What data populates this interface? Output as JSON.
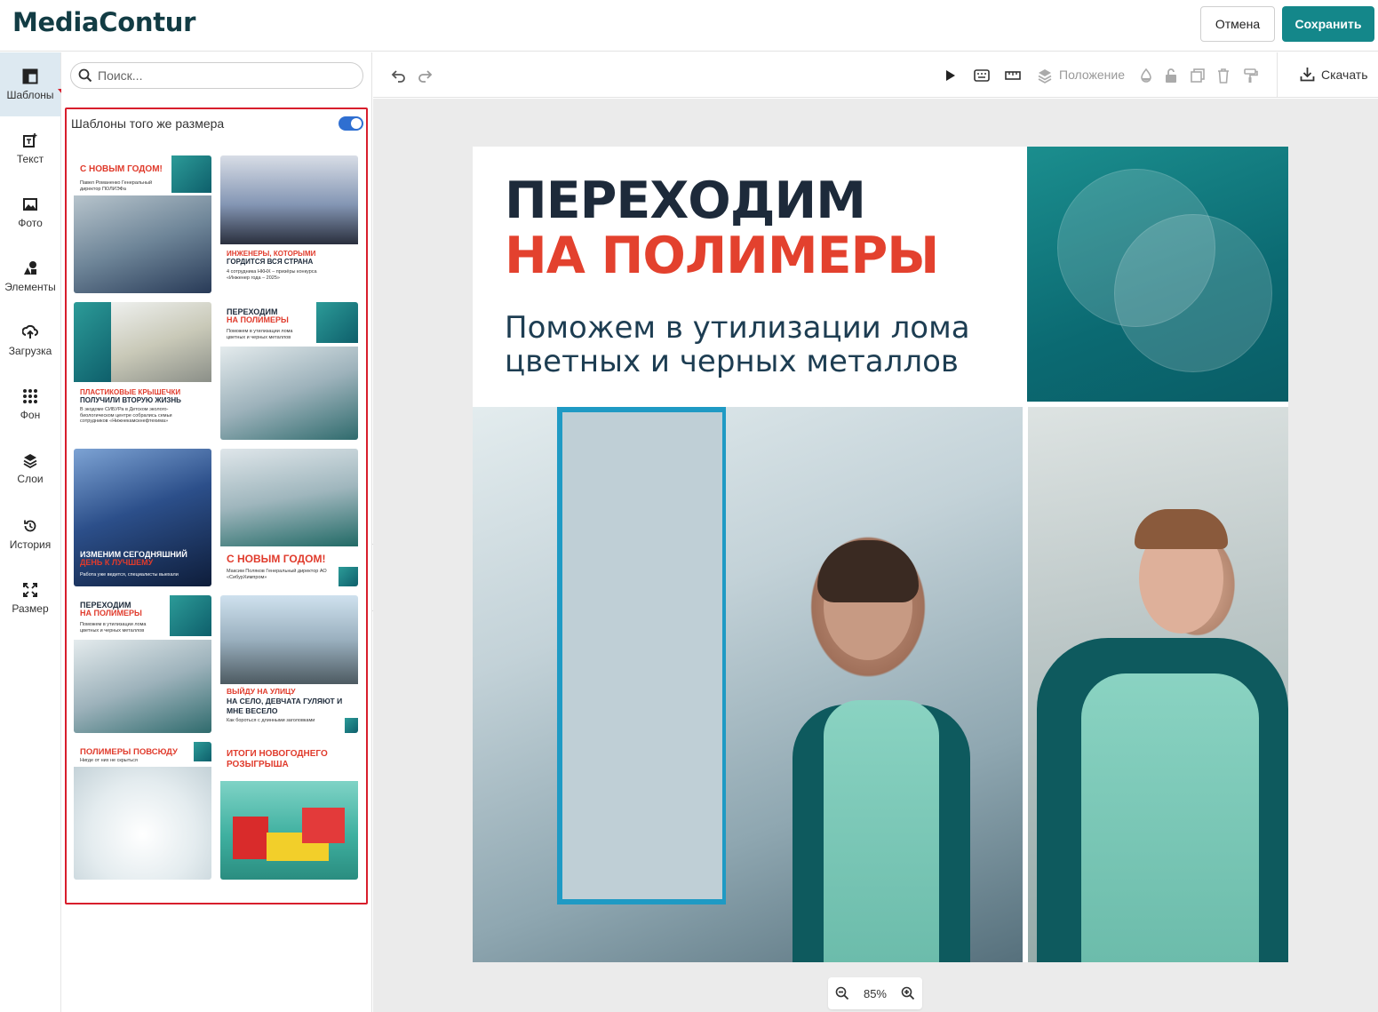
{
  "header": {
    "logo": "MediaContur",
    "cancel_label": "Отмена",
    "save_label": "Сохранить"
  },
  "colors": {
    "brand_teal": "#14878a",
    "accent_red": "#e3412e",
    "heading_dark": "#1d2a3a",
    "highlight_border": "#d81e2c"
  },
  "rail": [
    {
      "label": "Шаблоны",
      "icon": "templates-icon",
      "active": true
    },
    {
      "label": "Текст",
      "icon": "text-icon"
    },
    {
      "label": "Фото",
      "icon": "photo-icon"
    },
    {
      "label": "Элементы",
      "icon": "elements-icon"
    },
    {
      "label": "Загрузка",
      "icon": "upload-icon"
    },
    {
      "label": "Фон",
      "icon": "background-icon"
    },
    {
      "label": "Слои",
      "icon": "layers-icon"
    },
    {
      "label": "История",
      "icon": "history-icon"
    },
    {
      "label": "Размер",
      "icon": "resize-icon"
    }
  ],
  "panel": {
    "search_placeholder": "Поиск...",
    "same_size_label": "Шаблоны того же размера",
    "same_size_enabled": true,
    "templates": [
      {
        "title": "С НОВЫМ ГОДОМ!",
        "sub": "Павел Романенко Генеральный директор ПОЛИЭФа"
      },
      {
        "title": "ИНЖЕНЕРЫ, КОТОРЫМИ",
        "title2": "ГОРДИТСЯ ВСЯ СТРАНА",
        "sub": "4 сотрудника НКНХ – призёры конкурса «Инженер года – 2025»"
      },
      {
        "title": "ПЛАСТИКОВЫЕ КРЫШЕЧКИ",
        "title2": "ПОЛУЧИЛИ ВТОРУЮ ЖИЗНЬ",
        "sub": "В экодоме СИБУРа в Детском эколого-биологическом центре собрались семьи сотрудников «Нижнекамскнефтехима»"
      },
      {
        "title": "ПЕРЕХОДИМ",
        "title2": "НА ПОЛИМЕРЫ",
        "sub": "Поможем в утилизации лома цветных и черных металлов"
      },
      {
        "title": "ИЗМЕНИМ СЕГОДНЯШНИЙ",
        "title2": "ДЕНЬ К ЛУЧШЕМУ",
        "sub": "Работа уже ведется, специалисты выехали"
      },
      {
        "title": "С НОВЫМ ГОДОМ!",
        "sub": "Максим Поляков Генеральный директор АО «СибурХимпром»"
      },
      {
        "title": "ПЕРЕХОДИМ",
        "title2": "НА ПОЛИМЕРЫ",
        "sub": "Поможем в утилизации лома цветных и черных металлов"
      },
      {
        "title": "ВЫЙДУ НА УЛИЦУ",
        "title2": "НА СЕЛО, ДЕВЧАТА ГУЛЯЮТ И МНЕ ВЕСЕЛО",
        "sub": "Как бороться с длинными заголовками"
      },
      {
        "title": "ПОЛИМЕРЫ ПОВСЮДУ",
        "sub": "Нигде от них не скрыться"
      },
      {
        "title": "ИТОГИ НОВОГОДНЕГО",
        "title2": "РОЗЫГРЫША"
      }
    ]
  },
  "toolbar": {
    "position_label": "Положение",
    "download_label": "Скачать"
  },
  "canvas": {
    "heading_line1": "ПЕРЕХОДИМ",
    "heading_line2": "НА ПОЛИМЕРЫ",
    "subtitle": "Поможем в утилизации лома цветных и черных металлов"
  },
  "zoom": {
    "level": "85%"
  }
}
